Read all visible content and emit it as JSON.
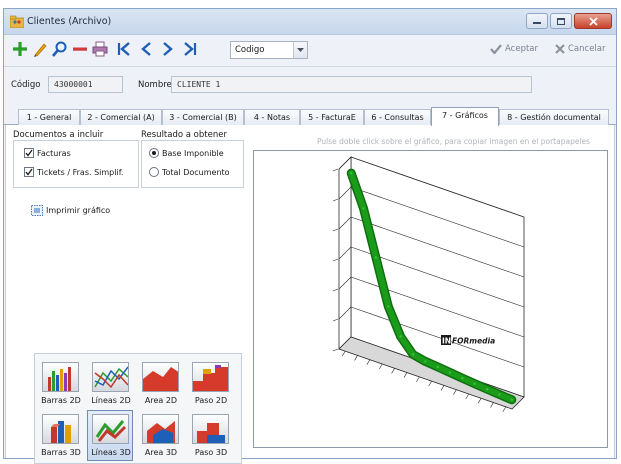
{
  "window": {
    "title": "Clientes (Archivo)"
  },
  "toolbar": {
    "search_field": "Codigo",
    "accept_label": "Aceptar",
    "cancel_label": "Cancelar"
  },
  "record": {
    "code_label": "Código",
    "code_value": "43000001",
    "name_label": "Nombre",
    "name_value": "CLIENTE 1"
  },
  "tabs": [
    {
      "label": "1 - General"
    },
    {
      "label": "2 - Comercial (A)"
    },
    {
      "label": "3 - Comercial (B)"
    },
    {
      "label": "4 - Notas"
    },
    {
      "label": "5 - FacturaE"
    },
    {
      "label": "6 - Consultas"
    },
    {
      "label": "7 - Gráficos",
      "active": true
    },
    {
      "label": "8 - Gestión documental"
    }
  ],
  "graficos": {
    "documentos_title": "Documentos a incluir",
    "documentos": [
      {
        "label": "Facturas",
        "checked": true
      },
      {
        "label": "Tickets / Fras. Simplif.",
        "checked": true
      }
    ],
    "resultado_title": "Resultado a obtener",
    "resultado": [
      {
        "label": "Base Imponible",
        "selected": true
      },
      {
        "label": "Total Documento",
        "selected": false
      }
    ],
    "print_label": "Imprimir gráfico",
    "hint": "Pulse doble click sobre el gráfico, para copiar imagen en el portapapeles",
    "watermark_box": "IN",
    "watermark_text": "FORmedia",
    "chart_types": [
      {
        "label": "Barras 2D",
        "icon": "bars-2d-icon"
      },
      {
        "label": "Líneas 2D",
        "icon": "lines-2d-icon"
      },
      {
        "label": "Area 2D",
        "icon": "area-2d-icon"
      },
      {
        "label": "Paso 2D",
        "icon": "step-2d-icon"
      },
      {
        "label": "Barras 3D",
        "icon": "bars-3d-icon"
      },
      {
        "label": "Líneas 3D",
        "icon": "lines-3d-icon",
        "selected": true
      },
      {
        "label": "Area 3D",
        "icon": "area-3d-icon"
      },
      {
        "label": "Paso 3D",
        "icon": "step-3d-icon"
      }
    ]
  },
  "colors": {
    "accent_green": "#1a9c1a",
    "add_icon": "#2a9e2a",
    "delete_icon": "#d13a3a",
    "nav_icon": "#1f5fb8",
    "edit_icon": "#e0a000"
  },
  "chart_data": {
    "type": "line",
    "series": [
      {
        "values": [
          1000,
          820,
          560,
          300,
          150,
          70,
          55,
          48,
          40,
          32,
          25,
          18,
          12,
          6
        ]
      }
    ],
    "ylim": [
      0,
      1000
    ],
    "grid": true
  }
}
